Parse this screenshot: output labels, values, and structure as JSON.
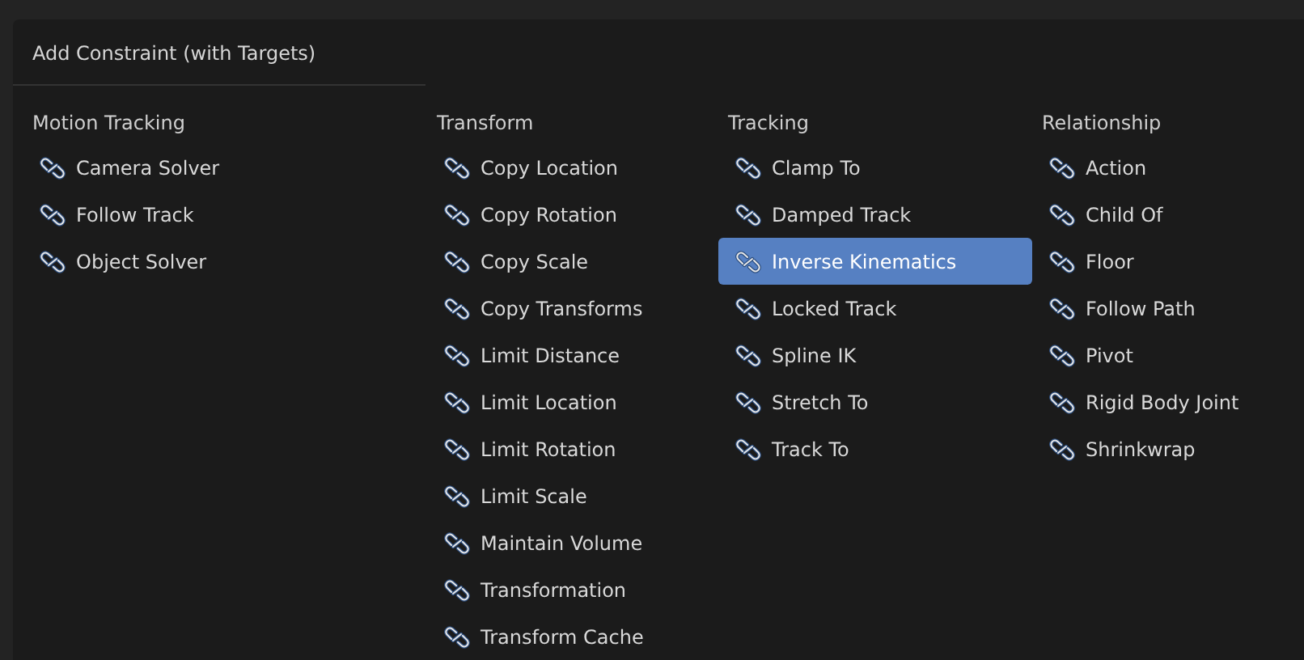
{
  "menu": {
    "title": "Add Constraint (with Targets)",
    "columns": [
      {
        "heading": "Motion Tracking",
        "items": [
          {
            "label": "Camera Solver",
            "selected": false
          },
          {
            "label": "Follow Track",
            "selected": false
          },
          {
            "label": "Object Solver",
            "selected": false
          }
        ]
      },
      {
        "heading": "Transform",
        "items": [
          {
            "label": "Copy Location",
            "selected": false
          },
          {
            "label": "Copy Rotation",
            "selected": false
          },
          {
            "label": "Copy Scale",
            "selected": false
          },
          {
            "label": "Copy Transforms",
            "selected": false
          },
          {
            "label": "Limit Distance",
            "selected": false
          },
          {
            "label": "Limit Location",
            "selected": false
          },
          {
            "label": "Limit Rotation",
            "selected": false
          },
          {
            "label": "Limit Scale",
            "selected": false
          },
          {
            "label": "Maintain Volume",
            "selected": false
          },
          {
            "label": "Transformation",
            "selected": false
          },
          {
            "label": "Transform Cache",
            "selected": false
          }
        ]
      },
      {
        "heading": "Tracking",
        "items": [
          {
            "label": "Clamp To",
            "selected": false
          },
          {
            "label": "Damped Track",
            "selected": false
          },
          {
            "label": "Inverse Kinematics",
            "selected": true
          },
          {
            "label": "Locked Track",
            "selected": false
          },
          {
            "label": "Spline IK",
            "selected": false
          },
          {
            "label": "Stretch To",
            "selected": false
          },
          {
            "label": "Track To",
            "selected": false
          }
        ]
      },
      {
        "heading": "Relationship",
        "items": [
          {
            "label": "Action",
            "selected": false
          },
          {
            "label": "Child Of",
            "selected": false
          },
          {
            "label": "Floor",
            "selected": false
          },
          {
            "label": "Follow Path",
            "selected": false
          },
          {
            "label": "Pivot",
            "selected": false
          },
          {
            "label": "Rigid Body Joint",
            "selected": false
          },
          {
            "label": "Shrinkwrap",
            "selected": false
          }
        ]
      }
    ]
  }
}
